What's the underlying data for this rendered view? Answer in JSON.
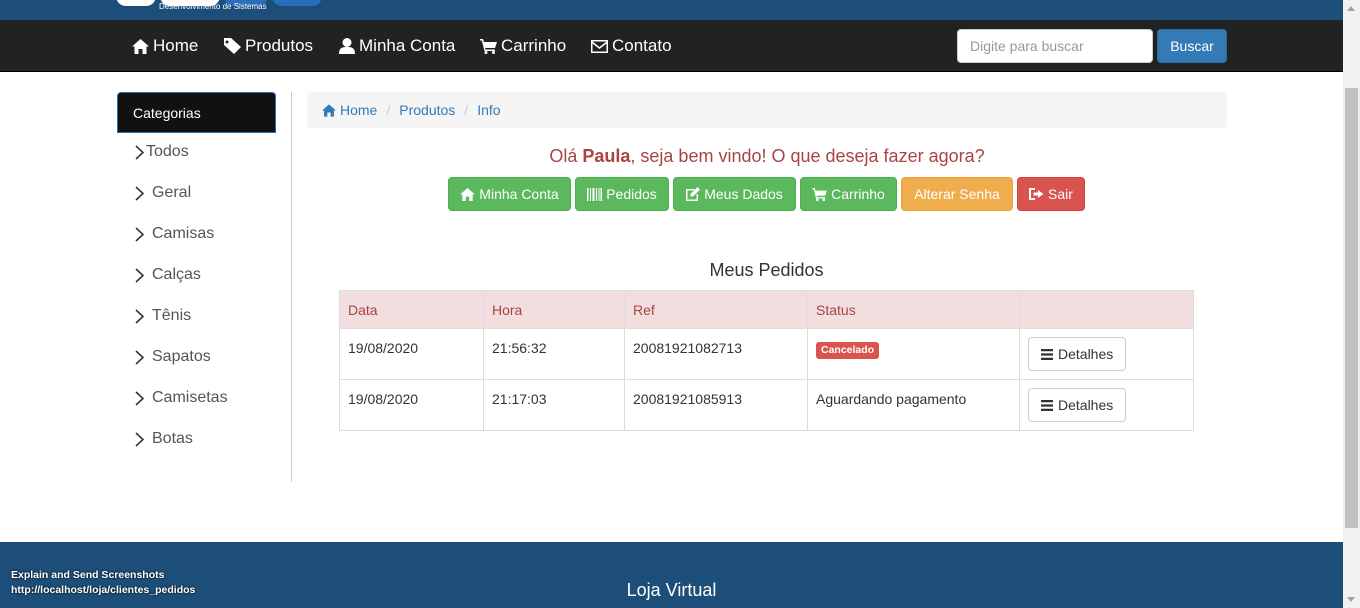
{
  "brand": {
    "subtitle": "Desenvolvimento de Sistemas",
    "colors": {
      "primary": "#1c4e79",
      "accent": "#2a6ebb"
    }
  },
  "nav": {
    "items": [
      {
        "label": "Home",
        "icon": "home-icon"
      },
      {
        "label": "Produtos",
        "icon": "tag-icon"
      },
      {
        "label": "Minha Conta",
        "icon": "user-icon"
      },
      {
        "label": "Carrinho",
        "icon": "cart-icon"
      },
      {
        "label": "Contato",
        "icon": "envelope-icon"
      }
    ],
    "search": {
      "placeholder": "Digite para buscar",
      "button": "Buscar"
    }
  },
  "sidebar": {
    "header": "Categorias",
    "items": [
      "Todos",
      "Geral",
      "Camisas",
      "Calças",
      "Tênis",
      "Sapatos",
      "Camisetas",
      "Botas"
    ]
  },
  "breadcrumb": [
    "Home",
    "Produtos",
    "Info"
  ],
  "welcome": {
    "greeting": "Olá ",
    "name": "Paula",
    "rest": ", seja bem vindo! O que deseja fazer agora?"
  },
  "actions": [
    {
      "label": "Minha Conta",
      "icon": "home-icon"
    },
    {
      "label": "Pedidos",
      "icon": "barcode-icon"
    },
    {
      "label": "Meus Dados",
      "icon": "edit-icon"
    },
    {
      "label": "Carrinho",
      "icon": "cart-icon"
    },
    {
      "label": "Alterar Senha",
      "icon": ""
    },
    {
      "label": "Sair",
      "icon": "logout-icon"
    }
  ],
  "orders": {
    "title": "Meus Pedidos",
    "columns": [
      "Data",
      "Hora",
      "Ref",
      "Status",
      ""
    ],
    "rows": [
      {
        "date": "19/08/2020",
        "time": "21:56:32",
        "ref": "20081921082713",
        "status": "Cancelado",
        "status_type": "badge-danger",
        "action": "Detalhes"
      },
      {
        "date": "19/08/2020",
        "time": "21:17:03",
        "ref": "20081921085913",
        "status": "Aguardando pagamento",
        "status_type": "text",
        "action": "Detalhes"
      }
    ]
  },
  "footer": {
    "title": "Loja Virtual"
  },
  "overlay": {
    "line1": "Explain and Send Screenshots",
    "line2": "http://localhost/loja/clientes_pedidos"
  }
}
